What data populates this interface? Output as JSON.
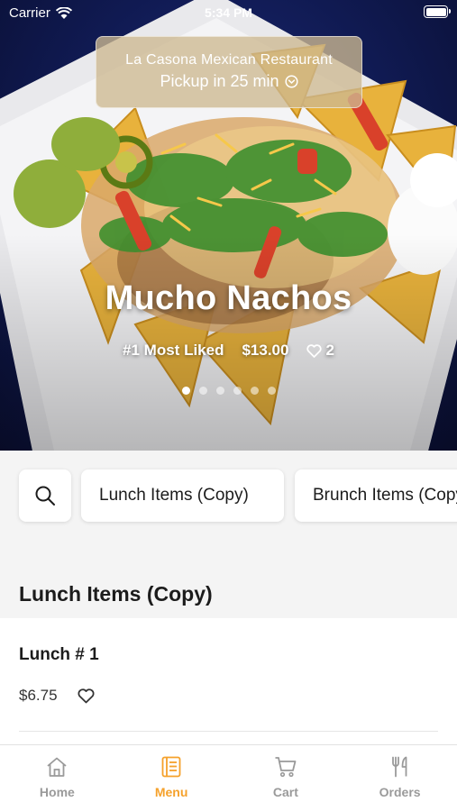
{
  "status_bar": {
    "carrier": "Carrier",
    "time": "5:34 PM"
  },
  "restaurant": {
    "name": "La Casona Mexican Restaurant",
    "pickup": "Pickup in 25 min"
  },
  "hero": {
    "dish_name": "Mucho Nachos",
    "rank": "#1 Most Liked",
    "price": "$13.00",
    "likes": "2",
    "slides_total": 6,
    "slide_active": 1
  },
  "categories": {
    "chip_1": "Lunch Items (Copy)",
    "chip_2": "Brunch Items (Copy)"
  },
  "menu": {
    "section_title": "Lunch Items (Copy)",
    "item": {
      "name": "Lunch # 1",
      "price": "$6.75"
    }
  },
  "tabs": {
    "home": "Home",
    "menu": "Menu",
    "cart": "Cart",
    "orders": "Orders",
    "active": "menu"
  },
  "colors": {
    "accent": "#f5a12b",
    "hero_bg": "#101a52",
    "inactive_tab": "#9a9a9a"
  },
  "icons": {
    "status": [
      "wifi-icon",
      "battery-icon"
    ],
    "pickup": "chevron-circle-icon",
    "likes": "heart-icon",
    "search": "search-icon",
    "tabs": [
      "home-icon",
      "menu-book-icon",
      "cart-icon",
      "utensils-icon"
    ]
  }
}
